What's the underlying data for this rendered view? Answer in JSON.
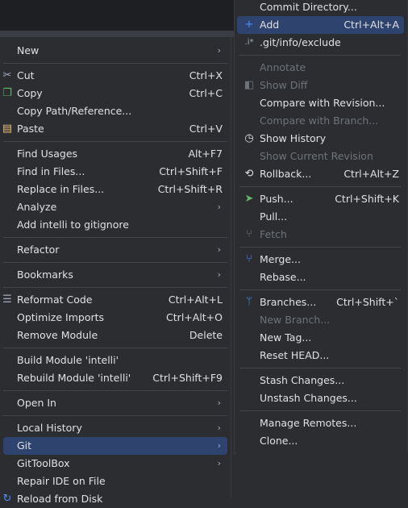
{
  "left_menu": {
    "new": {
      "label": "New"
    },
    "cut": {
      "label": "Cut",
      "shortcut": "Ctrl+X",
      "icon": "scissors-icon"
    },
    "copy": {
      "label": "Copy",
      "shortcut": "Ctrl+C",
      "icon": "copy-icon"
    },
    "copy_path": {
      "label": "Copy Path/Reference..."
    },
    "paste": {
      "label": "Paste",
      "shortcut": "Ctrl+V",
      "icon": "clipboard-icon"
    },
    "find_usages": {
      "label": "Find Usages",
      "shortcut": "Alt+F7"
    },
    "find_in_files": {
      "label": "Find in Files...",
      "shortcut": "Ctrl+Shift+F"
    },
    "replace_in_files": {
      "label": "Replace in Files...",
      "shortcut": "Ctrl+Shift+R"
    },
    "analyze": {
      "label": "Analyze"
    },
    "add_gitignore": {
      "label": "Add intelli to gitignore"
    },
    "refactor": {
      "label": "Refactor"
    },
    "bookmarks": {
      "label": "Bookmarks"
    },
    "reformat": {
      "label": "Reformat Code",
      "shortcut": "Ctrl+Alt+L",
      "icon": "reformat-icon"
    },
    "optimize": {
      "label": "Optimize Imports",
      "shortcut": "Ctrl+Alt+O"
    },
    "remove_module": {
      "label": "Remove Module",
      "shortcut": "Delete"
    },
    "build_module": {
      "label": "Build Module 'intelli'"
    },
    "rebuild_module": {
      "label": "Rebuild Module 'intelli'",
      "shortcut": "Ctrl+Shift+F9"
    },
    "open_in": {
      "label": "Open In"
    },
    "local_history": {
      "label": "Local History"
    },
    "git": {
      "label": "Git"
    },
    "gittoolbox": {
      "label": "GitToolBox"
    },
    "repair_ide": {
      "label": "Repair IDE on File"
    },
    "reload_disk": {
      "label": "Reload from Disk"
    }
  },
  "right_menu": {
    "commit_dir": {
      "label": "Commit Directory..."
    },
    "add": {
      "label": "Add",
      "shortcut": "Ctrl+Alt+A",
      "icon": "plus-icon"
    },
    "exclude": {
      "label": ".git/info/exclude",
      "icon": "ignore-file-icon"
    },
    "annotate": {
      "label": "Annotate"
    },
    "show_diff": {
      "label": "Show Diff",
      "icon": "diff-icon"
    },
    "compare_revision": {
      "label": "Compare with Revision..."
    },
    "compare_branch": {
      "label": "Compare with Branch..."
    },
    "show_history": {
      "label": "Show History",
      "icon": "history-icon"
    },
    "show_current_revision": {
      "label": "Show Current Revision"
    },
    "rollback": {
      "label": "Rollback...",
      "shortcut": "Ctrl+Alt+Z",
      "icon": "rollback-icon"
    },
    "push": {
      "label": "Push...",
      "shortcut": "Ctrl+Shift+K",
      "icon": "push-icon"
    },
    "pull": {
      "label": "Pull..."
    },
    "fetch": {
      "label": "Fetch",
      "icon": "fetch-icon"
    },
    "merge": {
      "label": "Merge...",
      "icon": "merge-icon"
    },
    "rebase": {
      "label": "Rebase..."
    },
    "branches": {
      "label": "Branches...",
      "shortcut": "Ctrl+Shift+`",
      "icon": "branch-icon"
    },
    "new_branch": {
      "label": "New Branch..."
    },
    "new_tag": {
      "label": "New Tag..."
    },
    "reset_head": {
      "label": "Reset HEAD..."
    },
    "stash": {
      "label": "Stash Changes..."
    },
    "unstash": {
      "label": "Unstash Changes..."
    },
    "manage_remotes": {
      "label": "Manage Remotes..."
    },
    "clone": {
      "label": "Clone..."
    }
  },
  "colors": {
    "accent": "#2e436e",
    "disabled": "#6f737a",
    "icon_blue": "#4d8ff7",
    "icon_green": "#5fb865"
  }
}
